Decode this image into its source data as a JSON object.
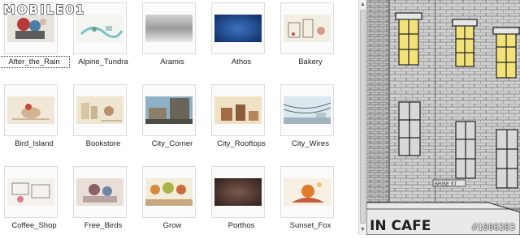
{
  "gallery": {
    "items": [
      {
        "label": "After_the_Rain",
        "selected": true
      },
      {
        "label": "Alpine_Tundra"
      },
      {
        "label": "Aramis"
      },
      {
        "label": "Athos"
      },
      {
        "label": "Bakery"
      },
      {
        "label": "Bird_Island"
      },
      {
        "label": "Bookstore"
      },
      {
        "label": "City_Corner"
      },
      {
        "label": "City_Rooftops"
      },
      {
        "label": "City_Wires"
      },
      {
        "label": "Coffee_Shop"
      },
      {
        "label": "Free_Birds"
      },
      {
        "label": "Grow"
      },
      {
        "label": "Porthos"
      },
      {
        "label": "Sunset_Fox"
      }
    ]
  },
  "preview": {
    "sign_text": "IN CAFE",
    "street_sign": "BRISE ST"
  },
  "watermark": {
    "logo": "MOBILE01",
    "id": "#1006383"
  },
  "colors": {
    "window_lit": "#f2e279",
    "sketch_bg": "#c9c9c9"
  }
}
